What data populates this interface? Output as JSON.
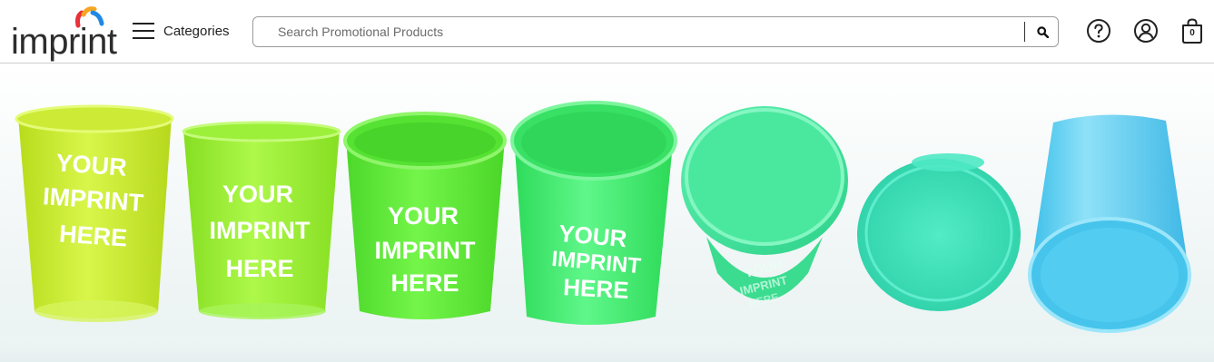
{
  "header": {
    "logo_text": "imprint",
    "categories_label": "Categories",
    "search_placeholder": "Search Promotional Products",
    "icons": [
      "hamburger-icon",
      "search-icon",
      "help-icon",
      "account-icon",
      "cart-icon"
    ],
    "cart_count": "0"
  },
  "hero": {
    "imprint_text_lines": [
      "YOUR",
      "IMPRINT",
      "HERE"
    ],
    "cup_colors": [
      "#c9ef2a",
      "#99f232",
      "#5fef33",
      "#3ff06a",
      "#3ee59a",
      "#3ee2bf",
      "#4fcdf0"
    ]
  },
  "colors": {
    "logo_red": "#e8313b",
    "logo_orange": "#f6a623",
    "logo_blue": "#1e88e5",
    "text_dark": "#222222"
  }
}
